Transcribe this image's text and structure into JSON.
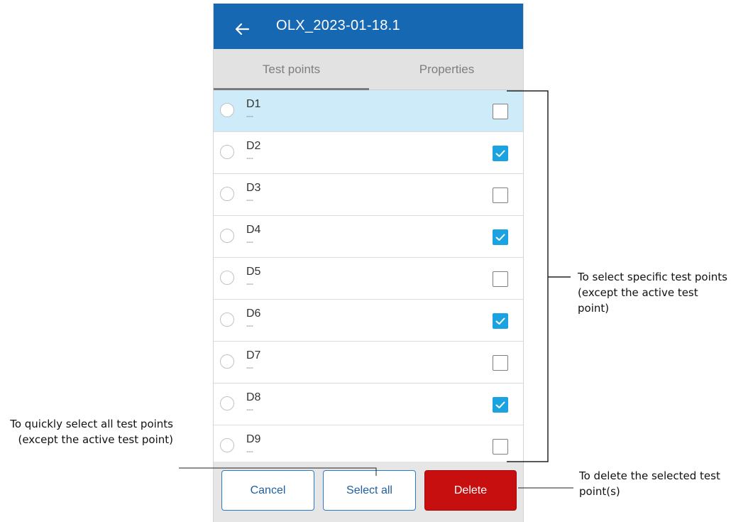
{
  "header": {
    "title": "OLX_2023-01-18.1",
    "back_icon": "arrow-left-icon",
    "color": "#1668b2"
  },
  "tabs": [
    {
      "label": "Test points",
      "selected": true
    },
    {
      "label": "Properties",
      "selected": false
    }
  ],
  "test_points": [
    {
      "name": "D1",
      "subtitle": "---",
      "active": true,
      "checked": false
    },
    {
      "name": "D2",
      "subtitle": "---",
      "active": false,
      "checked": true
    },
    {
      "name": "D3",
      "subtitle": "---",
      "active": false,
      "checked": false
    },
    {
      "name": "D4",
      "subtitle": "---",
      "active": false,
      "checked": true
    },
    {
      "name": "D5",
      "subtitle": "---",
      "active": false,
      "checked": false
    },
    {
      "name": "D6",
      "subtitle": "---",
      "active": false,
      "checked": true
    },
    {
      "name": "D7",
      "subtitle": "---",
      "active": false,
      "checked": false
    },
    {
      "name": "D8",
      "subtitle": "---",
      "active": false,
      "checked": true
    },
    {
      "name": "D9",
      "subtitle": "---",
      "active": false,
      "checked": false
    }
  ],
  "footer": {
    "cancel_label": "Cancel",
    "select_all_label": "Select all",
    "delete_label": "Delete"
  },
  "annotations": {
    "select_specific": "To select specific test points (except the active test point)",
    "select_all": "To quickly select all test points (except the active test point)",
    "delete": "To delete the selected test point(s)"
  },
  "colors": {
    "accent": "#1aa3e0",
    "active_row": "#cdebf8",
    "delete": "#c80f10"
  }
}
